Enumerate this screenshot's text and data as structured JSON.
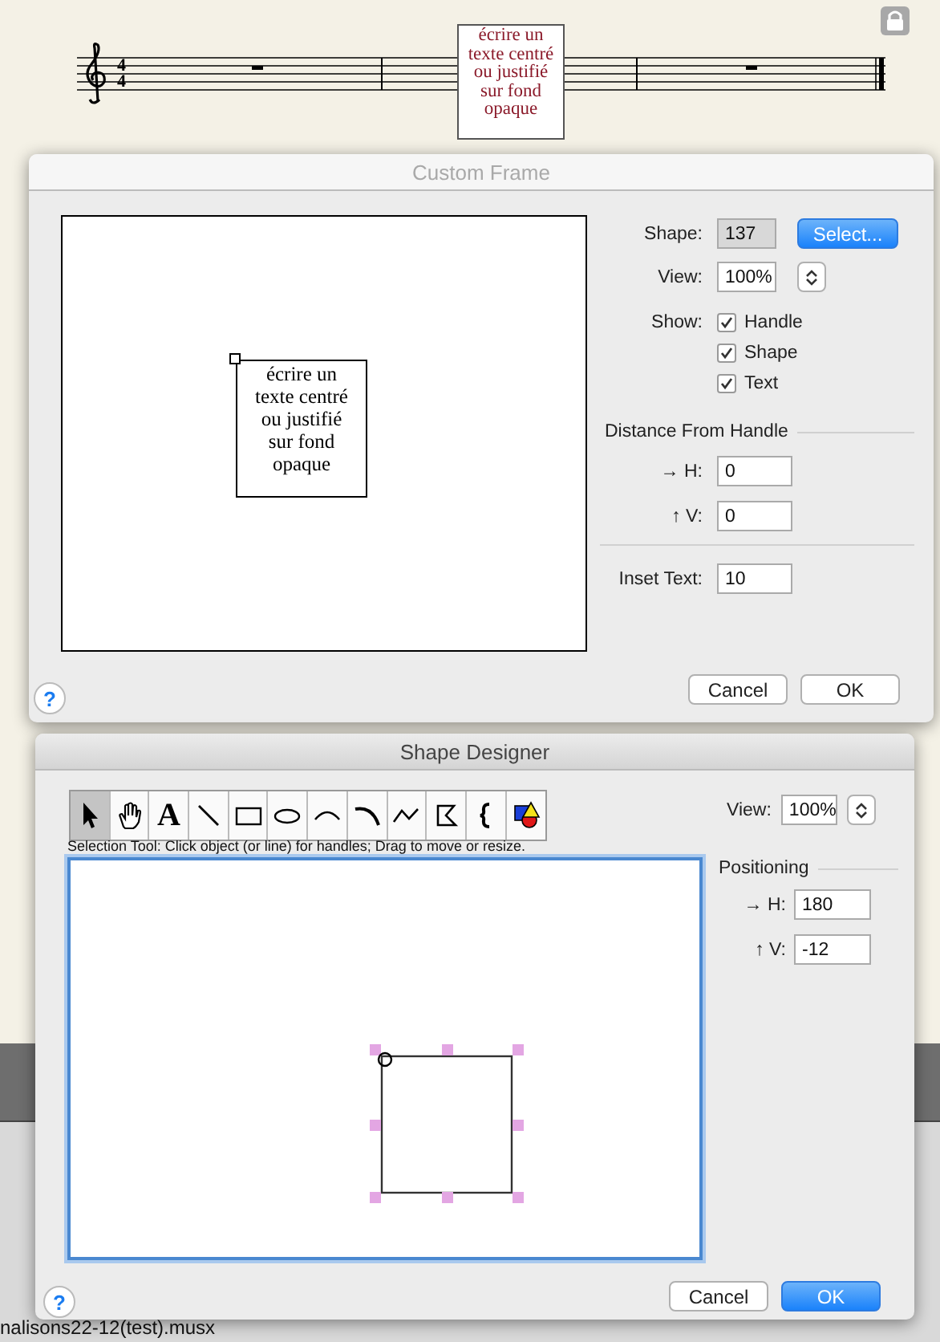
{
  "score": {
    "time_signature": {
      "numerator": "4",
      "denominator": "4"
    },
    "text_frame": {
      "lines": [
        "écrire un",
        "texte centré",
        "ou justifié",
        "sur fond",
        "opaque"
      ]
    }
  },
  "custom_frame": {
    "title": "Custom Frame",
    "active": false,
    "preview_lines": [
      "écrire un",
      "texte centré",
      "ou justifié",
      "sur fond",
      "opaque"
    ],
    "shape_label": "Shape:",
    "shape_value": "137",
    "select_button": "Select...",
    "view_label": "View:",
    "view_value": "100%",
    "show_label": "Show:",
    "show_options": [
      {
        "label": "Handle",
        "checked": true
      },
      {
        "label": "Shape",
        "checked": true
      },
      {
        "label": "Text",
        "checked": true
      }
    ],
    "distance_heading": "Distance From Handle",
    "h_label": "→ H:",
    "h_value": "0",
    "v_label": "↑ V:",
    "v_value": "0",
    "inset_label": "Inset Text:",
    "inset_value": "10",
    "help": "?",
    "buttons": [
      {
        "label": "Cancel",
        "default": false
      },
      {
        "label": "OK",
        "default": false
      }
    ]
  },
  "shape_designer": {
    "title": "Shape Designer",
    "active": true,
    "tools": [
      {
        "kind": "pointer",
        "selected": true
      },
      {
        "kind": "hand",
        "selected": false
      },
      {
        "kind": "text",
        "glyph": "A",
        "selected": false
      },
      {
        "kind": "line",
        "selected": false
      },
      {
        "kind": "rectangle",
        "selected": false
      },
      {
        "kind": "ellipse",
        "selected": false
      },
      {
        "kind": "arc",
        "selected": false
      },
      {
        "kind": "curve",
        "selected": false
      },
      {
        "kind": "polyline",
        "selected": false
      },
      {
        "kind": "polygon",
        "selected": false
      },
      {
        "kind": "bracket",
        "selected": false
      },
      {
        "kind": "color",
        "selected": false
      }
    ],
    "hint": "Selection Tool: Click object (or line) for handles; Drag to move or resize.",
    "view_label": "View:",
    "view_value": "100%",
    "positioning_heading": "Positioning",
    "h_label": "→ H:",
    "h_value": "180",
    "v_label": "↑ V:",
    "v_value": "-12",
    "help": "?",
    "buttons": [
      {
        "label": "Cancel",
        "default": false
      },
      {
        "label": "OK",
        "default": true
      }
    ]
  },
  "status_text": "nalisons22-12(test).musx"
}
